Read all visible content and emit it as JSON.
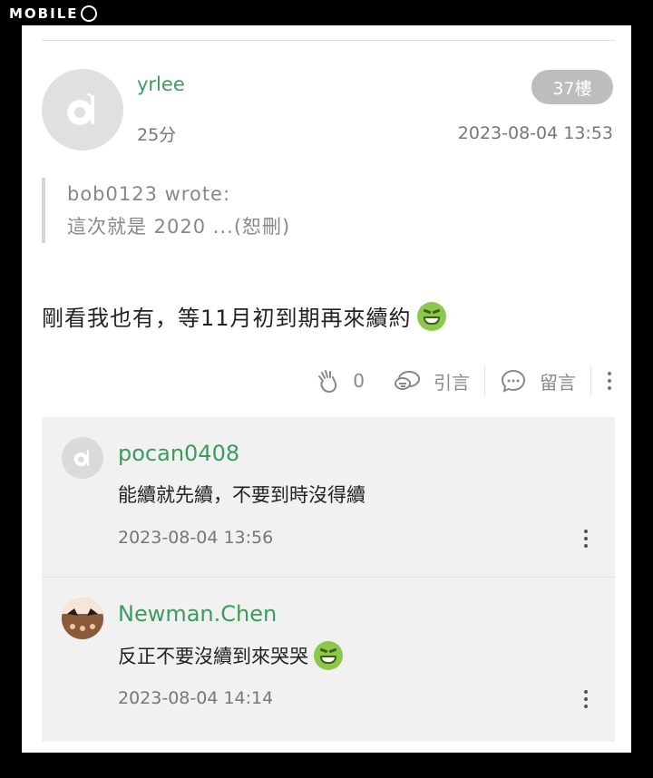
{
  "brand": {
    "logo_text": "MOBILE"
  },
  "post": {
    "username": "yrlee",
    "score": "25分",
    "floor": "37樓",
    "timestamp": "2023-08-04 13:53",
    "quote": {
      "author_line": "bob0123 wrote:",
      "text": "這次就是 2020 ...(恕刪)"
    },
    "body": "剛看我也有，等11月初到期再來續約",
    "body_emoji": "grin-emoji",
    "actions": {
      "like_count": "0",
      "quote_label": "引言",
      "comment_label": "留言"
    }
  },
  "comments": [
    {
      "username": "pocan0408",
      "text": "能續就先續，不要到時沒得續",
      "timestamp": "2023-08-04 13:56",
      "avatar": "default-avatar"
    },
    {
      "username": "Newman.Chen",
      "text": "反正不要沒續到來哭哭",
      "timestamp": "2023-08-04 14:14",
      "avatar": "custom-avatar",
      "emoji": "grin-emoji"
    }
  ],
  "colors": {
    "username_green": "#3a9d5d",
    "badge_gray": "#bdbdbd",
    "comment_bg": "#f1f1f1"
  }
}
